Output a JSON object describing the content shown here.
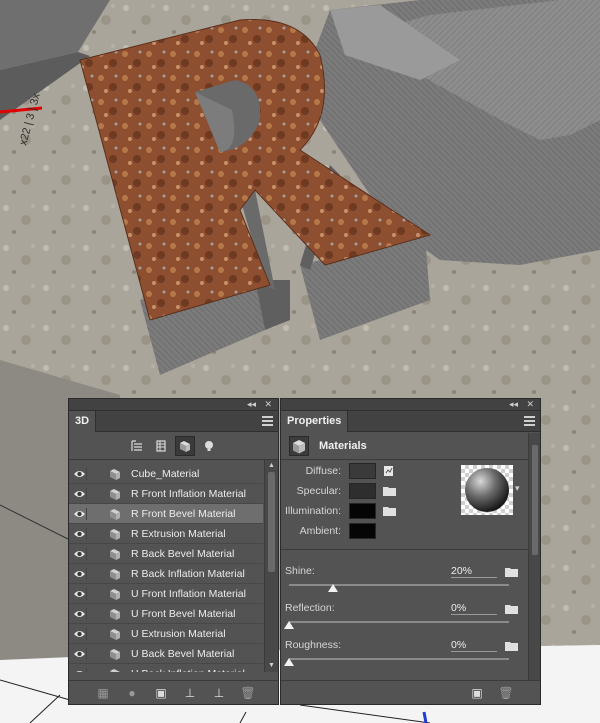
{
  "panel3d": {
    "tab_label": "3D",
    "collapse_glyph": "◂◂",
    "close_glyph": "✕",
    "filters": [
      {
        "name": "scene-filter",
        "icon": "scene-icon"
      },
      {
        "name": "mesh-filter",
        "icon": "mesh-icon"
      },
      {
        "name": "material-filter",
        "icon": "material-icon",
        "active": true
      },
      {
        "name": "light-filter",
        "icon": "light-bulb-icon"
      }
    ],
    "layers": [
      {
        "label": "Cube_Material",
        "selected": false
      },
      {
        "label": "R Front Inflation Material",
        "selected": false
      },
      {
        "label": "R Front Bevel Material",
        "selected": true
      },
      {
        "label": "R Extrusion Material",
        "selected": false
      },
      {
        "label": "R Back Bevel Material",
        "selected": false
      },
      {
        "label": "R Back Inflation Material",
        "selected": false
      },
      {
        "label": "U Front Inflation Material",
        "selected": false
      },
      {
        "label": "U Front Bevel Material",
        "selected": false
      },
      {
        "label": "U Extrusion Material",
        "selected": false
      },
      {
        "label": "U Back Bevel Material",
        "selected": false
      },
      {
        "label": "U Back Inflation Material",
        "selected": false
      }
    ],
    "footer_icons": [
      "scene-new-icon",
      "light-add-icon",
      "render-icon",
      "ground-icon",
      "move-ground-icon",
      "trash-icon"
    ]
  },
  "properties": {
    "tab_label": "Properties",
    "collapse_glyph": "◂◂",
    "close_glyph": "✕",
    "section_title": "Materials",
    "fields": [
      {
        "label": "Diffuse:",
        "color": "#3a3a3a",
        "has_folder": true,
        "texture": true
      },
      {
        "label": "Specular:",
        "color": "#2e2e2e",
        "has_folder": true
      },
      {
        "label": "Illumination:",
        "color": "#050505",
        "has_folder": true
      },
      {
        "label": "Ambient:",
        "color": "#050505",
        "has_folder": false
      }
    ],
    "sliders": [
      {
        "label": "Shine:",
        "value": "20%",
        "fraction": 0.2
      },
      {
        "label": "Reflection:",
        "value": "0%",
        "fraction": 0
      },
      {
        "label": "Roughness:",
        "value": "0%",
        "fraction": 0
      }
    ],
    "footer_icons": [
      "render-icon",
      "trash-icon"
    ]
  },
  "colors": {
    "panel_bg": "#535353",
    "panel_dark": "#424242",
    "selection": "#6e6e6e",
    "axis_red": "#e00000",
    "axis_blue": "#1f3bd6",
    "rust": "#9b5a37"
  }
}
